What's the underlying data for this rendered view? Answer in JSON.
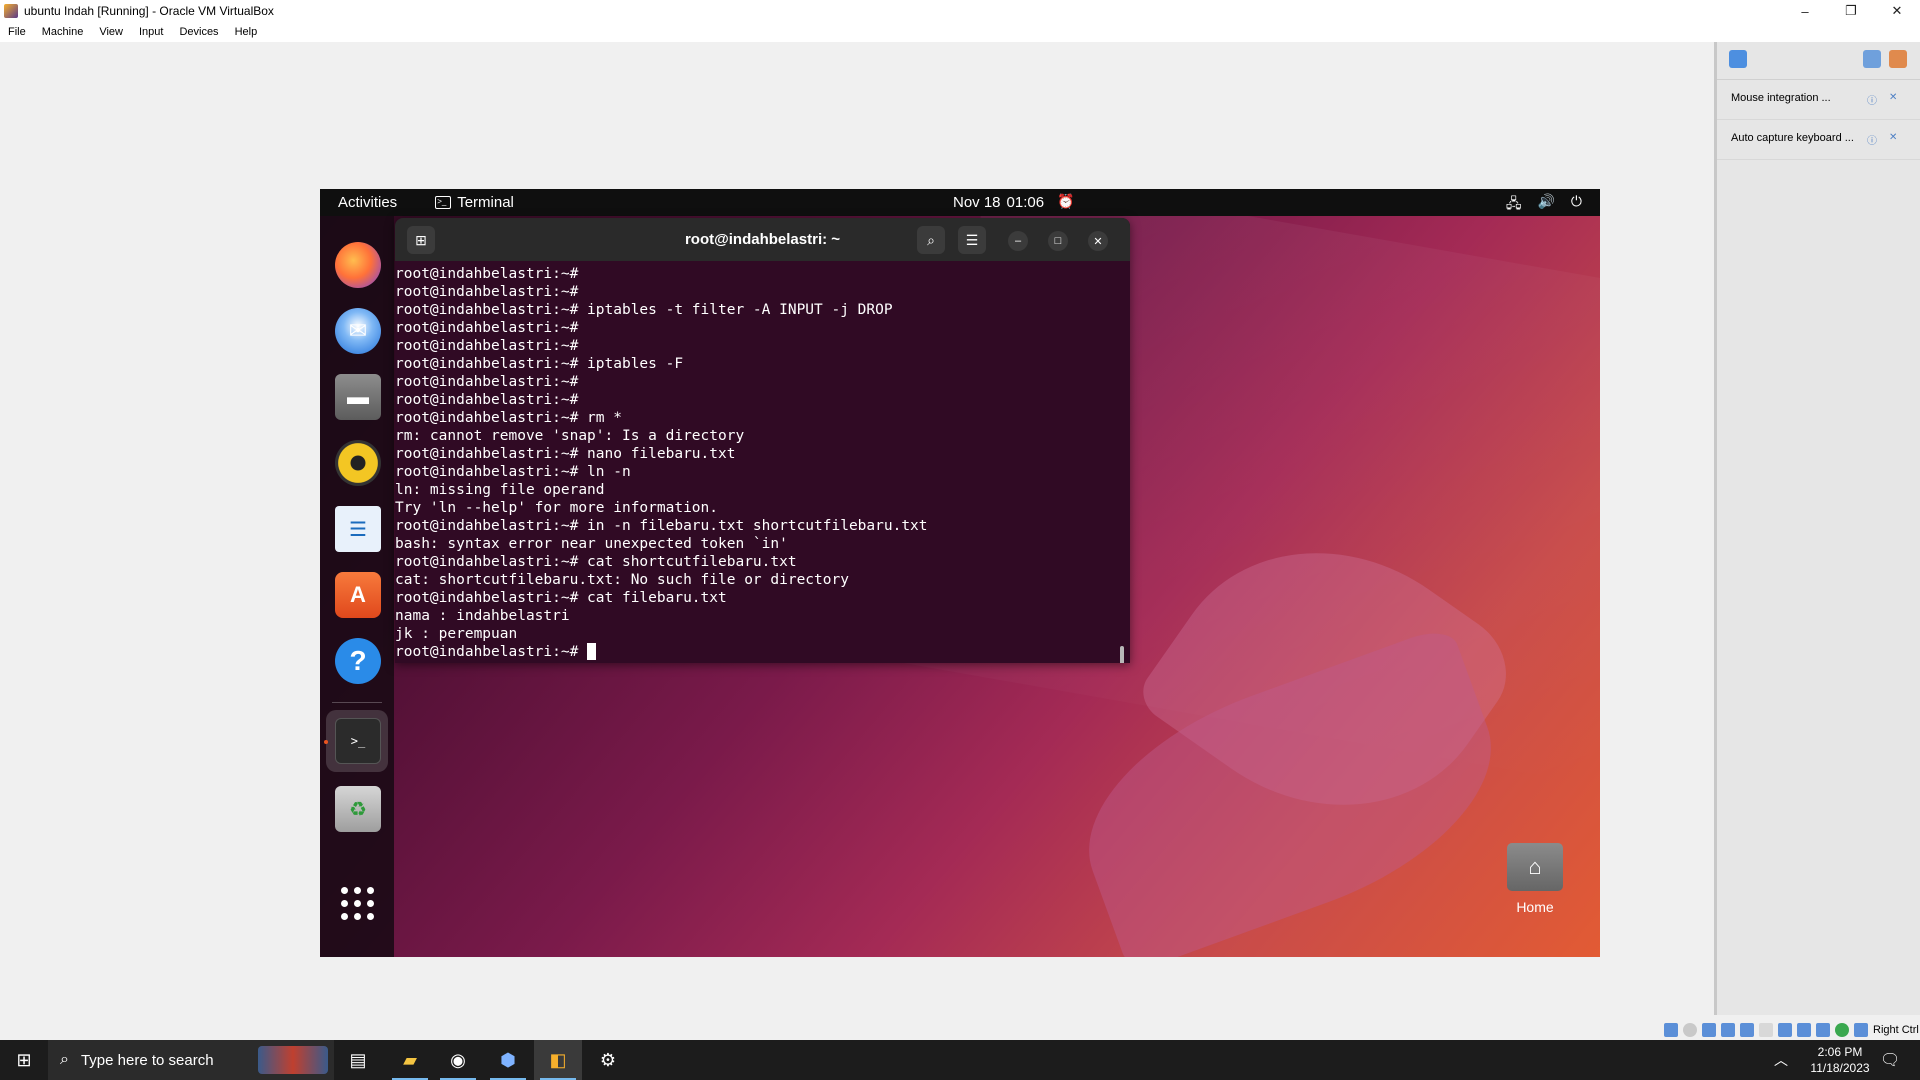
{
  "host": {
    "window_title": "ubuntu Indah [Running] - Oracle VM VirtualBox",
    "window_buttons": {
      "minimize": "–",
      "restore": "❐",
      "close": "✕"
    },
    "menu": [
      "File",
      "Machine",
      "View",
      "Input",
      "Devices",
      "Help"
    ]
  },
  "guest": {
    "topbar": {
      "activities": "Activities",
      "app_name": "Terminal",
      "date": "Nov 18",
      "time": "01:06"
    },
    "dock": {
      "items": [
        "firefox-icon",
        "thunderbird-icon",
        "files-icon",
        "rhythmbox-icon",
        "libreoffice-writer-icon",
        "app-center-icon",
        "help-icon",
        "terminal-icon",
        "trash-icon",
        "show-apps-icon"
      ],
      "terminal_glyph": ">_"
    },
    "desktop": {
      "home_label": "Home"
    },
    "terminal": {
      "title": "root@indahbelastri: ~",
      "lines": [
        "root@indahbelastri:~#",
        "root@indahbelastri:~#",
        "root@indahbelastri:~# iptables -t filter -A INPUT -j DROP",
        "root@indahbelastri:~#",
        "root@indahbelastri:~#",
        "root@indahbelastri:~# iptables -F",
        "root@indahbelastri:~#",
        "root@indahbelastri:~#",
        "root@indahbelastri:~# rm *",
        "rm: cannot remove 'snap': Is a directory",
        "root@indahbelastri:~# nano filebaru.txt",
        "root@indahbelastri:~# ln -n",
        "ln: missing file operand",
        "Try 'ln --help' for more information.",
        "root@indahbelastri:~# in -n filebaru.txt shortcutfilebaru.txt",
        "bash: syntax error near unexpected token `in'",
        "root@indahbelastri:~# cat shortcutfilebaru.txt",
        "cat: shortcutfilebaru.txt: No such file or directory",
        "root@indahbelastri:~# cat filebaru.txt",
        "nama : indahbelastri",
        "jk : perempuan"
      ],
      "prompt": "root@indahbelastri:~# "
    }
  },
  "vbox_panel": {
    "notifications": [
      "Mouse integration ...",
      "Auto capture keyboard ..."
    ],
    "host_key": "Right Ctrl"
  },
  "taskbar": {
    "search_placeholder": "Type here to search",
    "time": "2:06 PM",
    "date": "11/18/2023",
    "icons": [
      "task-view-icon",
      "file-explorer-icon",
      "browser-icon",
      "virtualbox-icon",
      "vm-window-icon",
      "settings-icon"
    ]
  },
  "colors": {
    "terminal_bg": "#300a24",
    "ubuntu_orange": "#e95420",
    "taskbar_bg": "#1c1c1c"
  }
}
